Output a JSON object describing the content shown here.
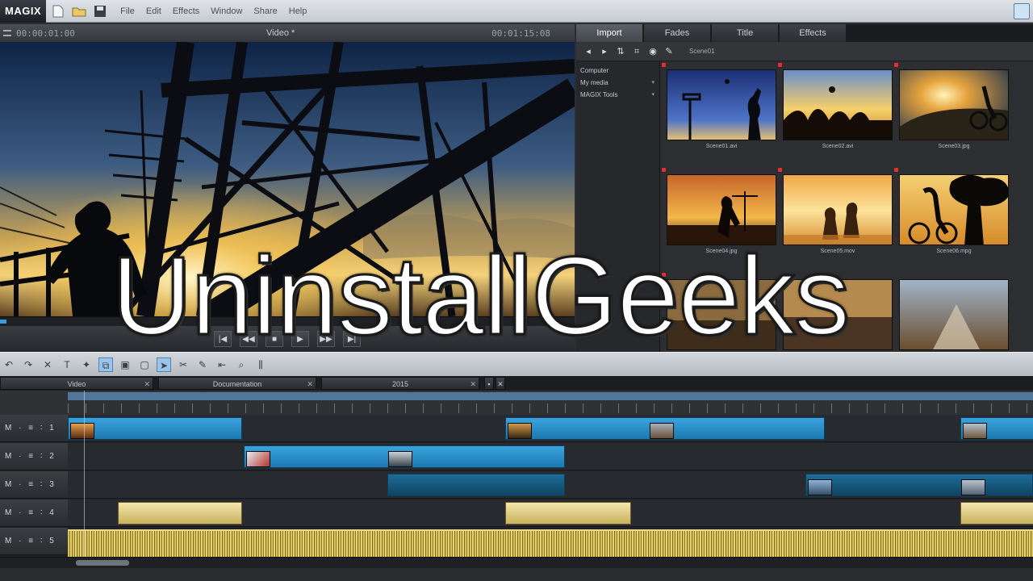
{
  "app": {
    "logo": "MAGIX",
    "menu": [
      "File",
      "Edit",
      "Effects",
      "Window",
      "Share",
      "Help"
    ]
  },
  "preview": {
    "timecode_start": "00:00:01:00",
    "title": "Video *",
    "timecode_end": "00:01:15:08",
    "progress_fraction": 0.0
  },
  "media_pool": {
    "tabs": [
      "Import",
      "Fades",
      "Title",
      "Effects"
    ],
    "active_tab": "Import",
    "path": "Scene01",
    "tree": [
      "Computer",
      "My media",
      "MAGIX Tools"
    ],
    "thumbnails": [
      {
        "label": "Scene01.avi",
        "icon": "basketball-silhouette-thumbnail"
      },
      {
        "label": "Scene02.avi",
        "icon": "group-sunset-thumbnail"
      },
      {
        "label": "Scene03.jpg",
        "icon": "cyclist-sunset-thumbnail"
      },
      {
        "label": "Scene04.jpg",
        "icon": "beach-silhouette-thumbnail"
      },
      {
        "label": "Scene05.mov",
        "icon": "couple-beach-thumbnail"
      },
      {
        "label": "Scene06.mpg",
        "icon": "bike-tree-thumbnail"
      },
      {
        "label": "",
        "icon": "landscape-thumbnail"
      },
      {
        "label": "",
        "icon": "landscape-thumbnail"
      },
      {
        "label": "",
        "icon": "road-thumbnail"
      }
    ]
  },
  "timeline": {
    "tabs": [
      {
        "label": "Video"
      },
      {
        "label": "Documentation"
      },
      {
        "label": "2015"
      }
    ],
    "tracks": [
      {
        "label": "M · ≡ ∶ 1"
      },
      {
        "label": "M · ≡ ∶ 2"
      },
      {
        "label": "M · ≡ ∶ 3"
      },
      {
        "label": "M · ≡ ∶ 4"
      },
      {
        "label": "M · ≡ ∶ 5"
      }
    ]
  },
  "status": {
    "text": ""
  },
  "watermark": {
    "text": "UninstallGeeks"
  },
  "colors": {
    "video_clip": "#2b8fca",
    "title_clip": "#e7d78f",
    "accent": "#5c8fbe"
  }
}
